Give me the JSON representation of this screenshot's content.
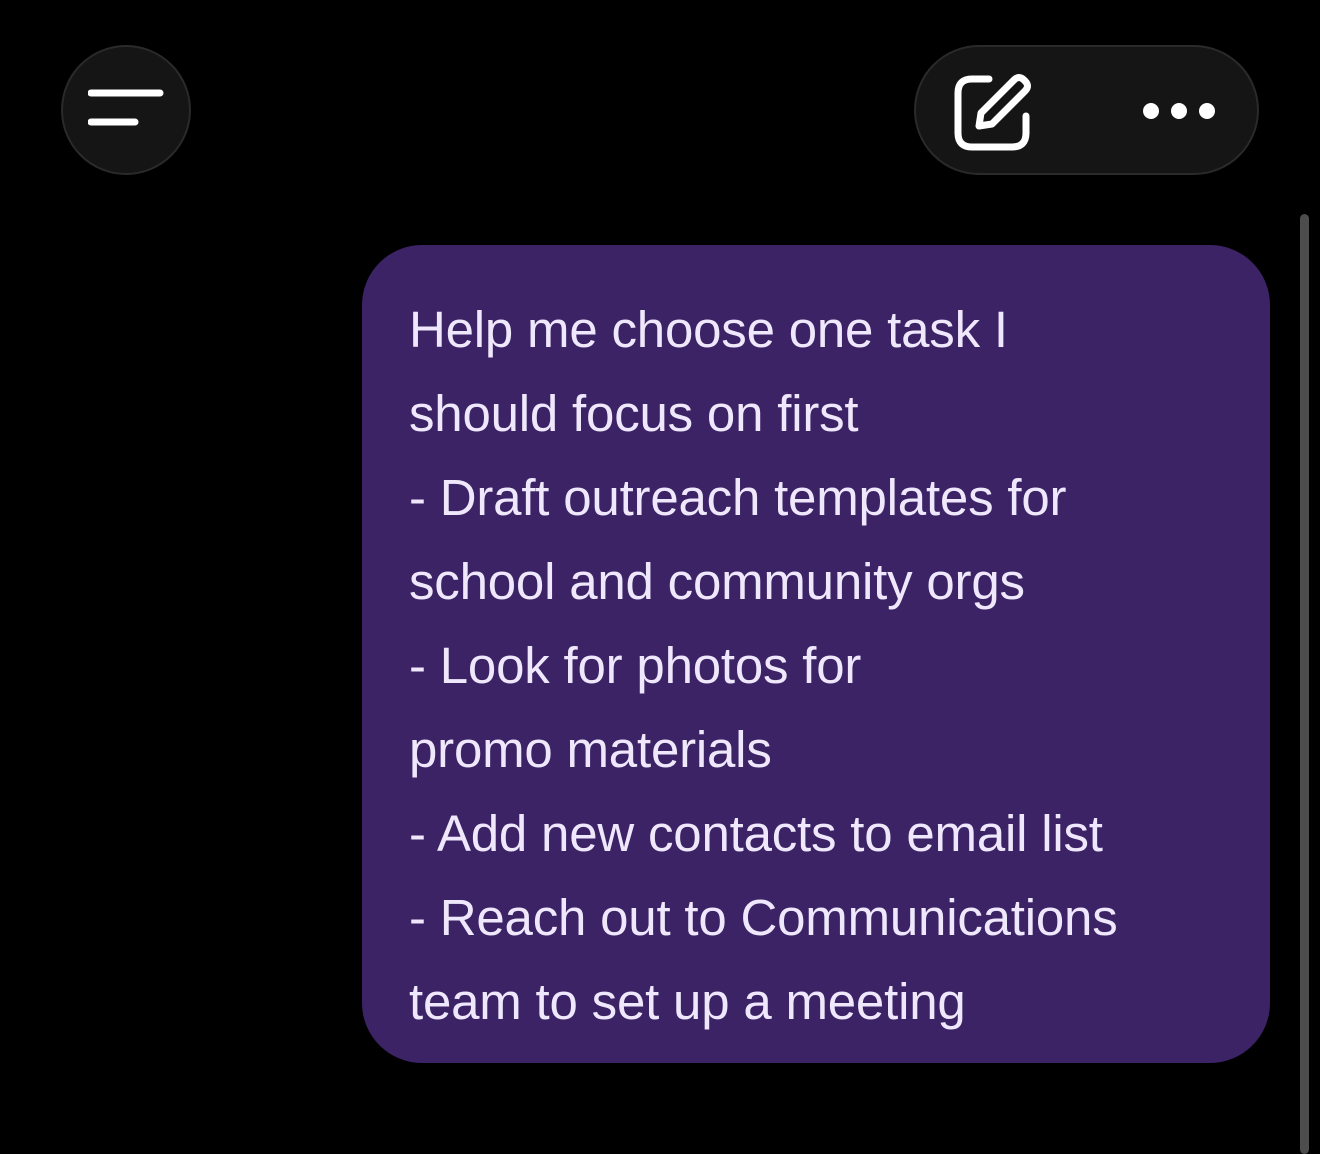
{
  "header": {
    "menu_icon": "menu-lines-icon",
    "compose_icon": "compose-edit-icon",
    "more_icon": "more-dots-icon"
  },
  "message": {
    "lines": [
      "Help me choose one task I",
      "should focus on first",
      "- Draft outreach templates for",
      "school and community orgs",
      "- Look for photos for",
      "promo materials",
      "- Add new contacts to email list",
      "- Reach out to Communications",
      "team to set up a meeting"
    ],
    "bubble_color": "#3c2366",
    "text_color": "#efe7fb"
  },
  "theme": {
    "background": "#000000",
    "button_background": "#151515",
    "icon_color": "#ffffff"
  }
}
